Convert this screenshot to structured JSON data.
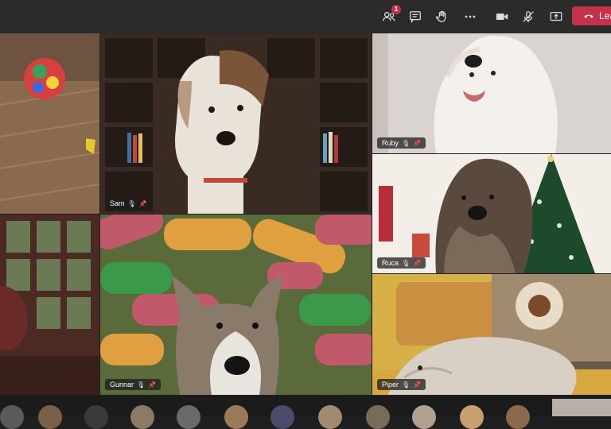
{
  "toolbar": {
    "participants_badge": "1",
    "leave_label": "Leave"
  },
  "participants": [
    {
      "name": "Sam"
    },
    {
      "name": "Ruby"
    },
    {
      "name": "Ruca"
    },
    {
      "name": "Gunnar"
    },
    {
      "name": "Piper"
    }
  ],
  "icons": {
    "participants": "people-icon",
    "chat": "chat-icon",
    "raise_hand": "hand-icon",
    "more": "more-icon",
    "camera": "camera-icon",
    "mic": "mic-off-icon",
    "share": "share-icon",
    "leave": "phone-hangup-icon"
  },
  "colors": {
    "leave_button": "#c4314b",
    "topbar": "#2b2b2b"
  }
}
